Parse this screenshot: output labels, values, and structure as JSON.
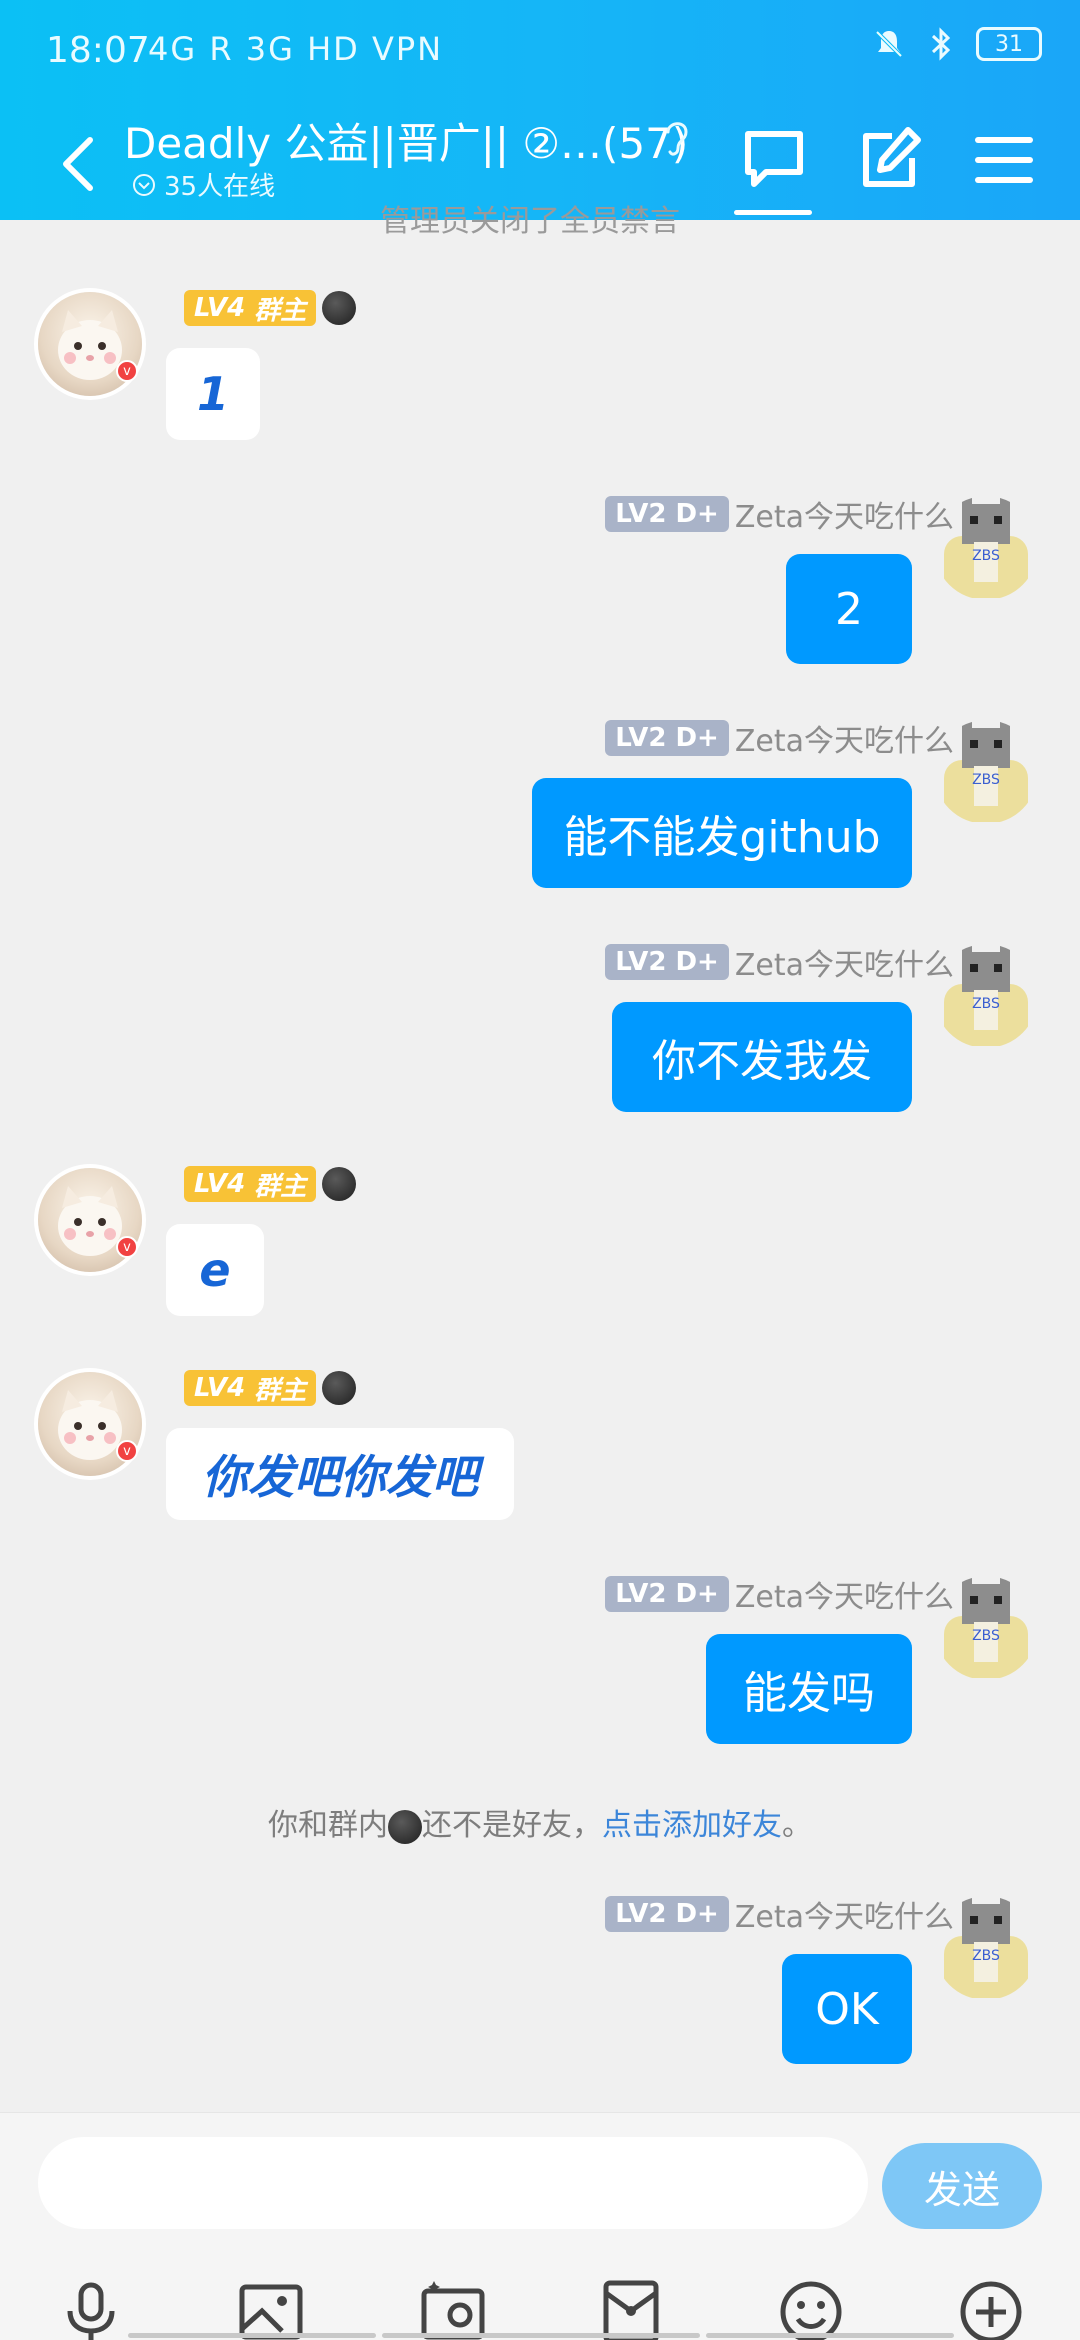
{
  "status": {
    "time": "18:07",
    "network": "4G  R 3G  HD VPN",
    "battery": "31"
  },
  "header": {
    "title": "Deadly 公益||晋广|| ②…(57)",
    "online": "35人在线",
    "accent": "#0bc0f5"
  },
  "hidden_text": "管理员关闭了全员禁言",
  "messages": [
    {
      "side": "left",
      "level": "LV4",
      "role": "群主",
      "text": "1"
    },
    {
      "side": "right",
      "level": "LV2 D+",
      "name": "Zeta今天吃什么",
      "text": "2"
    },
    {
      "side": "right",
      "level": "LV2 D+",
      "name": "Zeta今天吃什么",
      "text": "能不能发github"
    },
    {
      "side": "right",
      "level": "LV2 D+",
      "name": "Zeta今天吃什么",
      "text": "你不发我发"
    },
    {
      "side": "left",
      "level": "LV4",
      "role": "群主",
      "text": "e"
    },
    {
      "side": "left",
      "level": "LV4",
      "role": "群主",
      "text": "你发吧你发吧"
    },
    {
      "side": "right",
      "level": "LV2 D+",
      "name": "Zeta今天吃什么",
      "text": "能发吗"
    },
    {
      "side": "right",
      "level": "LV2 D+",
      "name": "Zeta今天吃什么",
      "text": "OK"
    }
  ],
  "system_note": {
    "prefix": "你和群内",
    "middle": "还不是好友，",
    "link": "点击添加好友",
    "suffix": "。"
  },
  "input": {
    "placeholder": "",
    "send_label": "发送"
  },
  "toolbar_icons": [
    "microphone-icon",
    "image-icon",
    "camera-icon",
    "red-packet-icon",
    "emoji-icon",
    "plus-icon"
  ]
}
